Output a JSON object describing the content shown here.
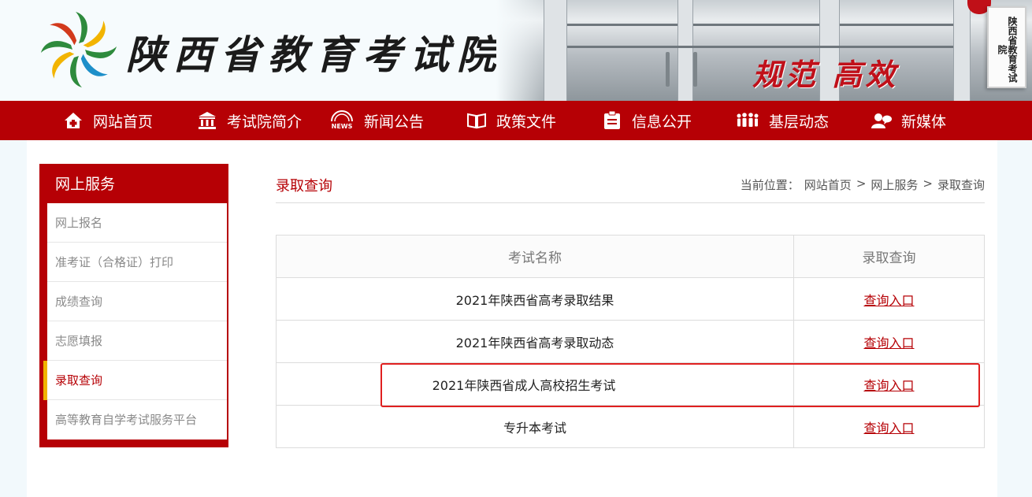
{
  "header": {
    "site_title": "陕西省教育考试院",
    "slogan": "规范 高效",
    "plaque_text": "陕西省教育考试院"
  },
  "nav": {
    "items": [
      {
        "label": "网站首页",
        "icon": "home-icon"
      },
      {
        "label": "考试院简介",
        "icon": "building-icon"
      },
      {
        "label": "新闻公告",
        "icon": "news-icon"
      },
      {
        "label": "政策文件",
        "icon": "book-icon"
      },
      {
        "label": "信息公开",
        "icon": "clipboard-icon"
      },
      {
        "label": "基层动态",
        "icon": "people-icon"
      },
      {
        "label": "新媒体",
        "icon": "user-chat-icon"
      }
    ],
    "news_icon_text": "NEWS"
  },
  "sidebar": {
    "title": "网上服务",
    "items": [
      {
        "label": "网上报名"
      },
      {
        "label": "准考证（合格证）打印"
      },
      {
        "label": "成绩查询"
      },
      {
        "label": "志愿填报"
      },
      {
        "label": "录取查询",
        "active": true
      },
      {
        "label": "高等教育自学考试服务平台"
      }
    ]
  },
  "content": {
    "title": "录取查询",
    "breadcrumb": {
      "prefix": "当前位置：",
      "items": [
        "网站首页",
        "网上服务",
        "录取查询"
      ],
      "separator": ">"
    },
    "table": {
      "headers": [
        "考试名称",
        "录取查询"
      ],
      "rows": [
        {
          "name": "2021年陕西省高考录取结果",
          "link": "查询入口"
        },
        {
          "name": "2021年陕西省高考录取动态",
          "link": "查询入口"
        },
        {
          "name": "2021年陕西省成人高校招生考试",
          "link": "查询入口",
          "highlighted": true
        },
        {
          "name": "专升本考试",
          "link": "查询入口"
        }
      ]
    }
  },
  "colors": {
    "brand_red": "#b60005",
    "active_marker": "#f0b400",
    "highlight_border": "#e02020"
  }
}
